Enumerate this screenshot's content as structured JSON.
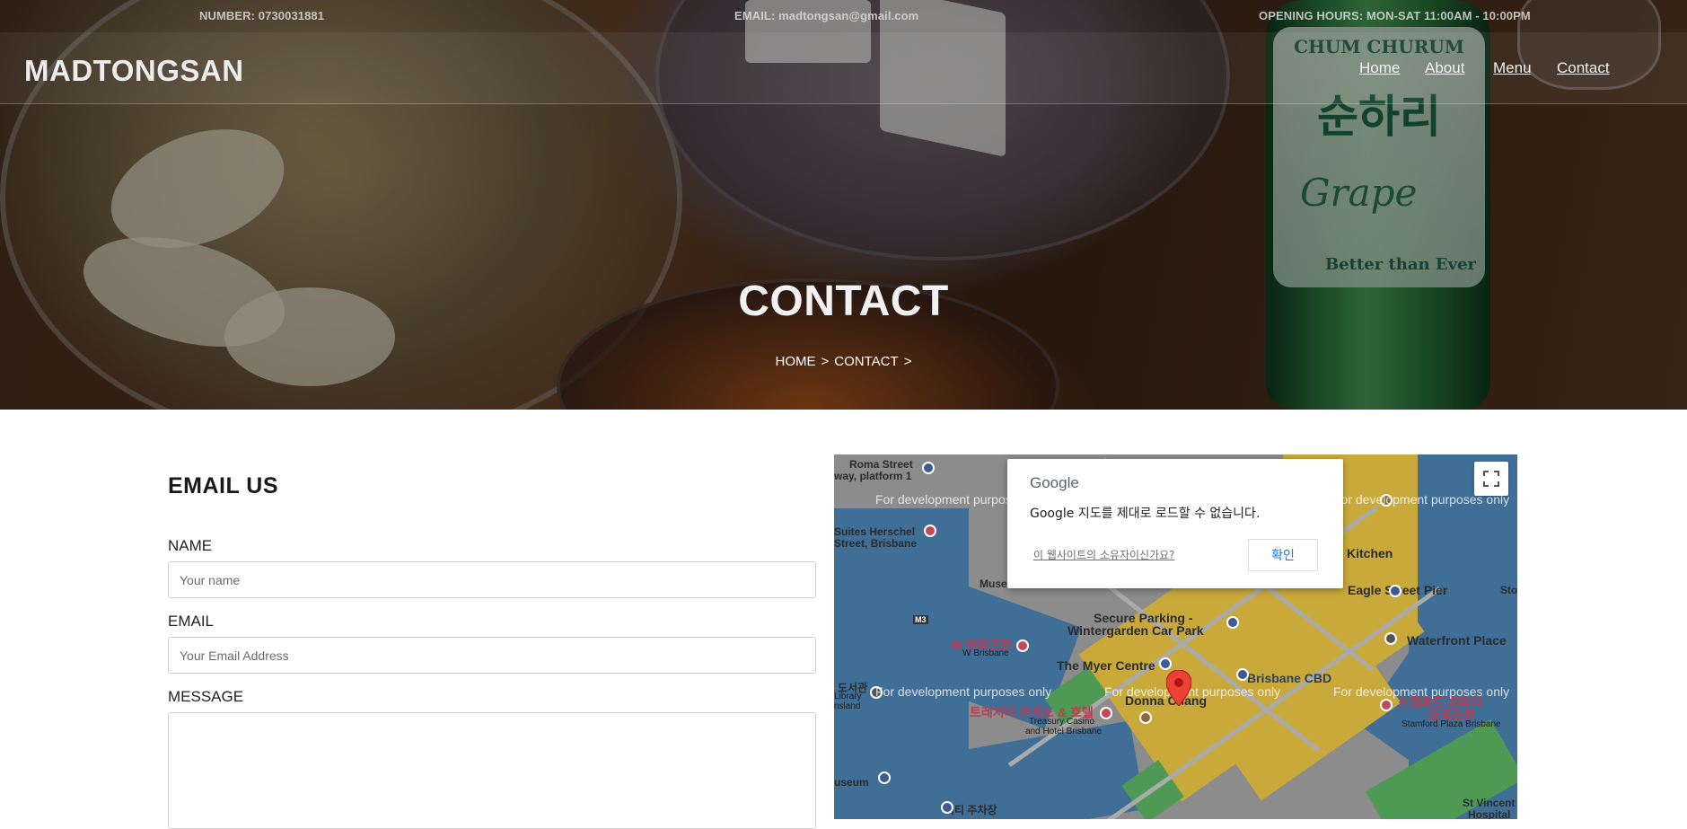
{
  "topbar": {
    "number": "NUMBER: 0730031881",
    "email": "EMAIL: madtongsan@gmail.com",
    "hours": "OPENING HOURS: MON-SAT 11:00AM - 10:00PM"
  },
  "header": {
    "logo": "MADTONGSAN",
    "nav": [
      "Home",
      "About",
      "Menu",
      "Contact"
    ]
  },
  "hero": {
    "title": "CONTACT",
    "breadcrumb": [
      "HOME",
      ">",
      "CONTACT",
      ">"
    ],
    "bottle_brand": "CHUM CHURUM",
    "bottle_korean": "순하리",
    "bottle_flavor": "Grape",
    "bottle_tagline": "Better than Ever"
  },
  "form": {
    "title": "EMAIL US",
    "name_label": "NAME",
    "name_placeholder": "Your name",
    "email_label": "EMAIL",
    "email_placeholder": "Your Email Address",
    "message_label": "MESSAGE"
  },
  "map": {
    "dialog_brand": "Google",
    "dialog_message": "Google 지도를 제대로 로드할 수 없습니다.",
    "dialog_owner_link": "이 웹사이트의 소유자이신가요?",
    "dialog_ok": "확인",
    "watermark": "For development purposes only",
    "labels": {
      "roma": "Roma Street",
      "platform": "way, platform 1",
      "suites": "Suites Herschel",
      "street_bris": "Street, Brisbane",
      "museum": "Museum",
      "secure": "Secure Parking -",
      "wintergarden": "Wintergarden Car Park",
      "w_kor": "W 브리즈번",
      "w_bris": "W Brisbane",
      "myer": "The Myer Centre",
      "brisbane_cbd": "Brisbane CBD",
      "donna": "Donna Chang",
      "treasury_kor": "트레저리 카지노 & 호텔",
      "treasury1": "Treasury Casino",
      "treasury2": "and Hotel Brisbane",
      "eagle": "Eagle Street Pier",
      "waterfront": "Waterfront Place",
      "kitchen": "Kitchen",
      "stamford_kor": "스탬퍼드 플라자",
      "stamford_kor2": "브리즈번",
      "stamford": "Stamford Plaza Brisbane",
      "sto": "Sto",
      "library_kor": "도서관",
      "library": "Library",
      "island": "nsland",
      "museum2": "useum",
      "city_kor": "시티 주차장",
      "st_vincent": "St Vincent",
      "hospital": "Hospital",
      "m3": "M3"
    }
  },
  "colors": {
    "accent": "#1a73e8",
    "pin": "#ea4335",
    "poi_red": "#c5475a",
    "poi_blue": "#3b5b92"
  }
}
